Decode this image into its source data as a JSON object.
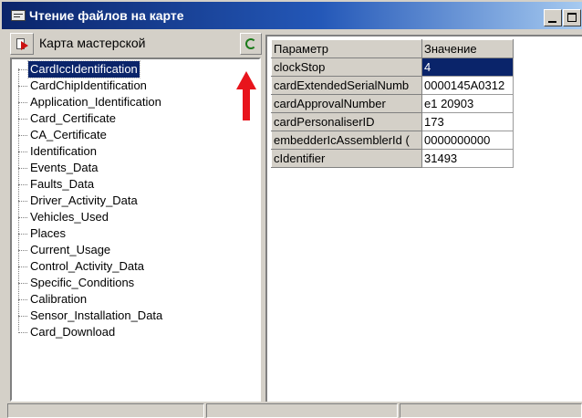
{
  "window": {
    "title": "Чтение файлов на карте",
    "icon": "card-reader-icon"
  },
  "toolbar": {
    "export_icon": "export-icon",
    "workshop_label": "Карта мастерской",
    "refresh_icon": "refresh-icon"
  },
  "tree": {
    "selected_index": 0,
    "items": [
      {
        "label": "CardIccIdentification"
      },
      {
        "label": "CardChipIdentification"
      },
      {
        "label": "Application_Identification"
      },
      {
        "label": "Card_Certificate"
      },
      {
        "label": "CA_Certificate"
      },
      {
        "label": "Identification"
      },
      {
        "label": "Events_Data"
      },
      {
        "label": "Faults_Data"
      },
      {
        "label": "Driver_Activity_Data"
      },
      {
        "label": "Vehicles_Used"
      },
      {
        "label": "Places"
      },
      {
        "label": "Current_Usage"
      },
      {
        "label": "Control_Activity_Data"
      },
      {
        "label": "Specific_Conditions"
      },
      {
        "label": "Calibration"
      },
      {
        "label": "Sensor_Installation_Data"
      },
      {
        "label": "Card_Download"
      }
    ]
  },
  "grid": {
    "columns": [
      "Параметр",
      "Значение"
    ],
    "rows": [
      {
        "param": "clockStop",
        "value": "4"
      },
      {
        "param": "cardExtendedSerialNumb",
        "value": "0000145A0312"
      },
      {
        "param": "cardApprovalNumber",
        "value": "e1 20903"
      },
      {
        "param": "cardPersonaliserID",
        "value": "173"
      },
      {
        "param": "embedderIcAssemblerId (",
        "value": "0000000000"
      },
      {
        "param": "cIdentifier",
        "value": "31493"
      }
    ],
    "selected_row": 0
  },
  "annotation": {
    "icon": "red-up-arrow-icon",
    "color": "#e8141c"
  },
  "colors": {
    "title_start": "#0a246a",
    "title_end": "#a6caf0",
    "selection": "#0a246a",
    "face": "#d4d0c8"
  }
}
